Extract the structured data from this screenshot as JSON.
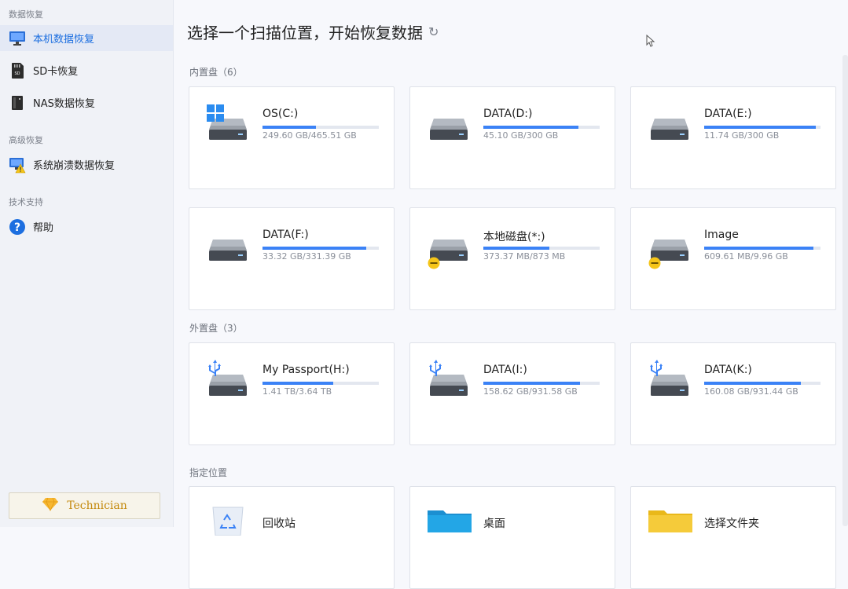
{
  "sidebar": {
    "sections": [
      {
        "label": "数据恢复",
        "items": [
          {
            "label": "本机数据恢复",
            "icon": "monitor-icon",
            "active": true
          },
          {
            "label": "SD卡恢复",
            "icon": "sd-card-icon"
          },
          {
            "label": "NAS数据恢复",
            "icon": "nas-icon"
          }
        ]
      },
      {
        "label": "高级恢复",
        "items": [
          {
            "label": "系统崩溃数据恢复",
            "icon": "crashed-system-icon"
          }
        ]
      },
      {
        "label": "技术支持",
        "items": [
          {
            "label": "帮助",
            "icon": "help-icon"
          }
        ]
      }
    ],
    "technician_label": "Technician"
  },
  "main": {
    "title": "选择一个扫描位置，开始恢复数据",
    "groups": [
      {
        "label": "内置盘（6）"
      },
      {
        "label": "外置盘（3）"
      },
      {
        "label": "指定位置"
      }
    ],
    "drives": [
      {
        "name": "OS(C:)",
        "size": "249.60 GB/465.51 GB",
        "used": 0.46,
        "badge": "windows"
      },
      {
        "name": "DATA(D:)",
        "size": "45.10 GB/300 GB",
        "used": 0.82,
        "badge": ""
      },
      {
        "name": "DATA(E:)",
        "size": "11.74 GB/300 GB",
        "used": 0.96,
        "badge": ""
      },
      {
        "name": "DATA(F:)",
        "size": "33.32 GB/331.39 GB",
        "used": 0.89,
        "badge": ""
      },
      {
        "name": "本地磁盘(*:)",
        "size": "373.37 MB/873 MB",
        "used": 0.57,
        "badge": "warning"
      },
      {
        "name": "Image",
        "size": "609.61 MB/9.96 GB",
        "used": 0.94,
        "badge": "warning"
      },
      {
        "name": "My Passport(H:)",
        "size": "1.41 TB/3.64 TB",
        "used": 0.61,
        "badge": "usb"
      },
      {
        "name": "DATA(I:)",
        "size": "158.62 GB/931.58 GB",
        "used": 0.83,
        "badge": "usb"
      },
      {
        "name": "DATA(K:)",
        "size": "160.08 GB/931.44 GB",
        "used": 0.83,
        "badge": "usb"
      }
    ],
    "locations": [
      {
        "name": "回收站",
        "icon": "recycle-bin-icon"
      },
      {
        "name": "桌面",
        "icon": "desktop-folder-icon"
      },
      {
        "name": "选择文件夹",
        "icon": "folder-icon"
      }
    ]
  },
  "colors": {
    "accent": "#1d6fe0",
    "bar_fill": "#3b82f6",
    "bar_track": "#e3e7ef",
    "badge_warning": "#f5c518",
    "usb": "#3b82f6"
  }
}
